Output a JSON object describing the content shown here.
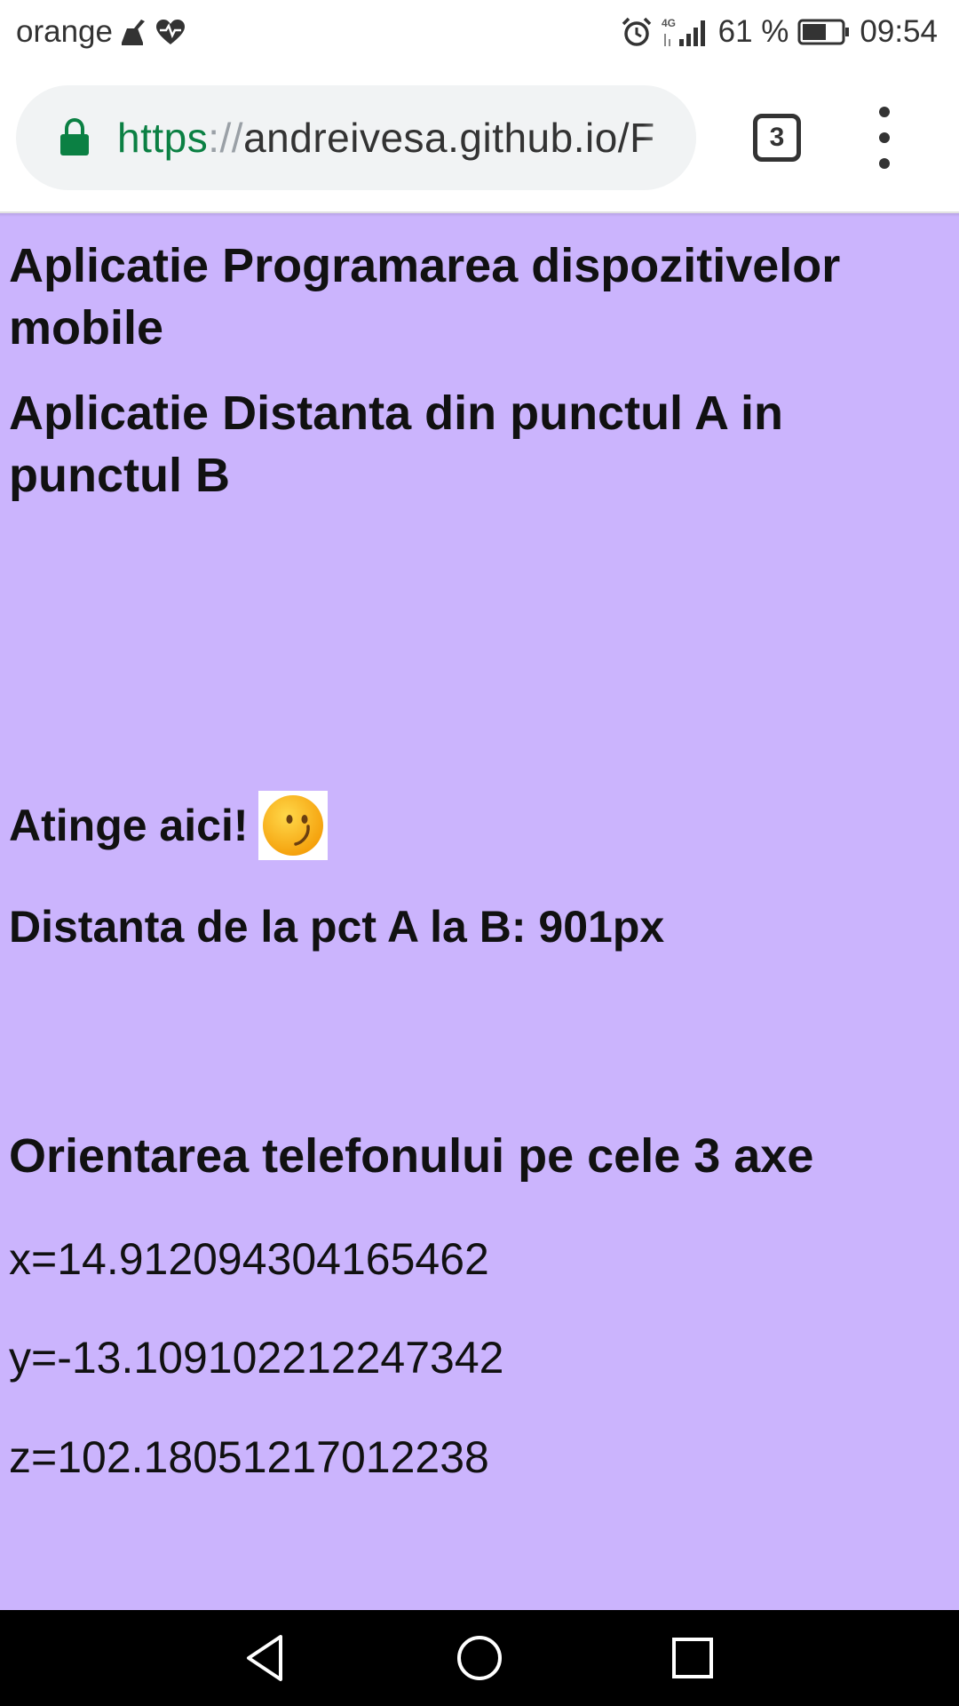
{
  "status_bar": {
    "carrier": "orange",
    "battery_percent": "61 %",
    "battery_level": 0.61,
    "time": "09:54",
    "network_type": "4G"
  },
  "browser": {
    "url_scheme": "https",
    "url_separator": "://",
    "url_host": "andreivesa.github.io/F",
    "tab_count": "3",
    "accent_color": "#0b8043"
  },
  "page": {
    "background_color": "#cbb4fd",
    "title1": "Aplicatie Programarea dispozitivelor mobile",
    "title2": "Aplicatie Distanta din punctul A in punctul B",
    "touch_label": "Atinge aici!",
    "distance_text": "Distanta de la pct A la B: 901px",
    "orientation_title": "Orientarea telefonului pe cele 3 axe",
    "x_value": "x=14.912094304165462",
    "y_value": "y=-13.109102212247342",
    "z_value": "z=102.18051217012238"
  },
  "icons": {
    "lock": "lock-icon",
    "smiley": "smiley-icon",
    "alarm": "alarm-icon",
    "signal": "signal-icon",
    "battery": "battery-icon"
  }
}
